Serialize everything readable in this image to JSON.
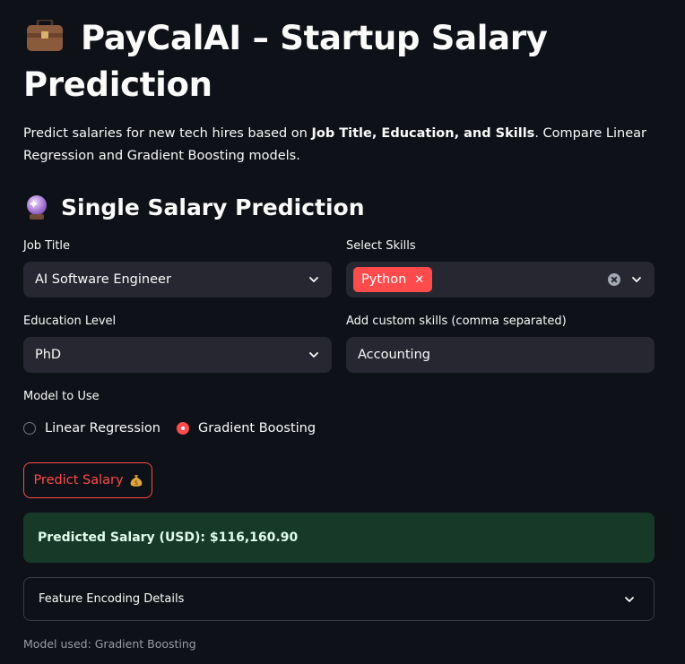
{
  "header": {
    "title_emoji_icon": "briefcase-icon",
    "title": "PayCalAI – Startup Salary Prediction",
    "intro_before": "Predict salaries for new tech hires based on ",
    "intro_bold": "Job Title, Education, and Skills",
    "intro_after": ". Compare Linear Regression and Gradient Boosting models."
  },
  "section": {
    "emoji_icon": "crystal-ball-icon",
    "title": "Single Salary Prediction"
  },
  "form": {
    "job_title_label": "Job Title",
    "job_title_value": "AI Software Engineer",
    "skills_label": "Select Skills",
    "skills_tags": [
      "Python"
    ],
    "education_label": "Education Level",
    "education_value": "PhD",
    "custom_skills_label": "Add custom skills (comma separated)",
    "custom_skills_value": "Accounting",
    "model_label": "Model to Use",
    "model_options": [
      "Linear Regression",
      "Gradient Boosting"
    ],
    "model_selected": "Gradient Boosting",
    "predict_button": "Predict Salary",
    "predict_icon": "money-bag-icon"
  },
  "result": {
    "text": "Predicted Salary (USD): $116,160.90"
  },
  "expander": {
    "label": "Feature Encoding Details"
  },
  "caption": "Model used: Gradient Boosting",
  "colors": {
    "background": "#0e1117",
    "input_bg": "#262730",
    "accent": "#ff4b4b",
    "success_bg": "#173928",
    "success_text": "#dffde9"
  }
}
